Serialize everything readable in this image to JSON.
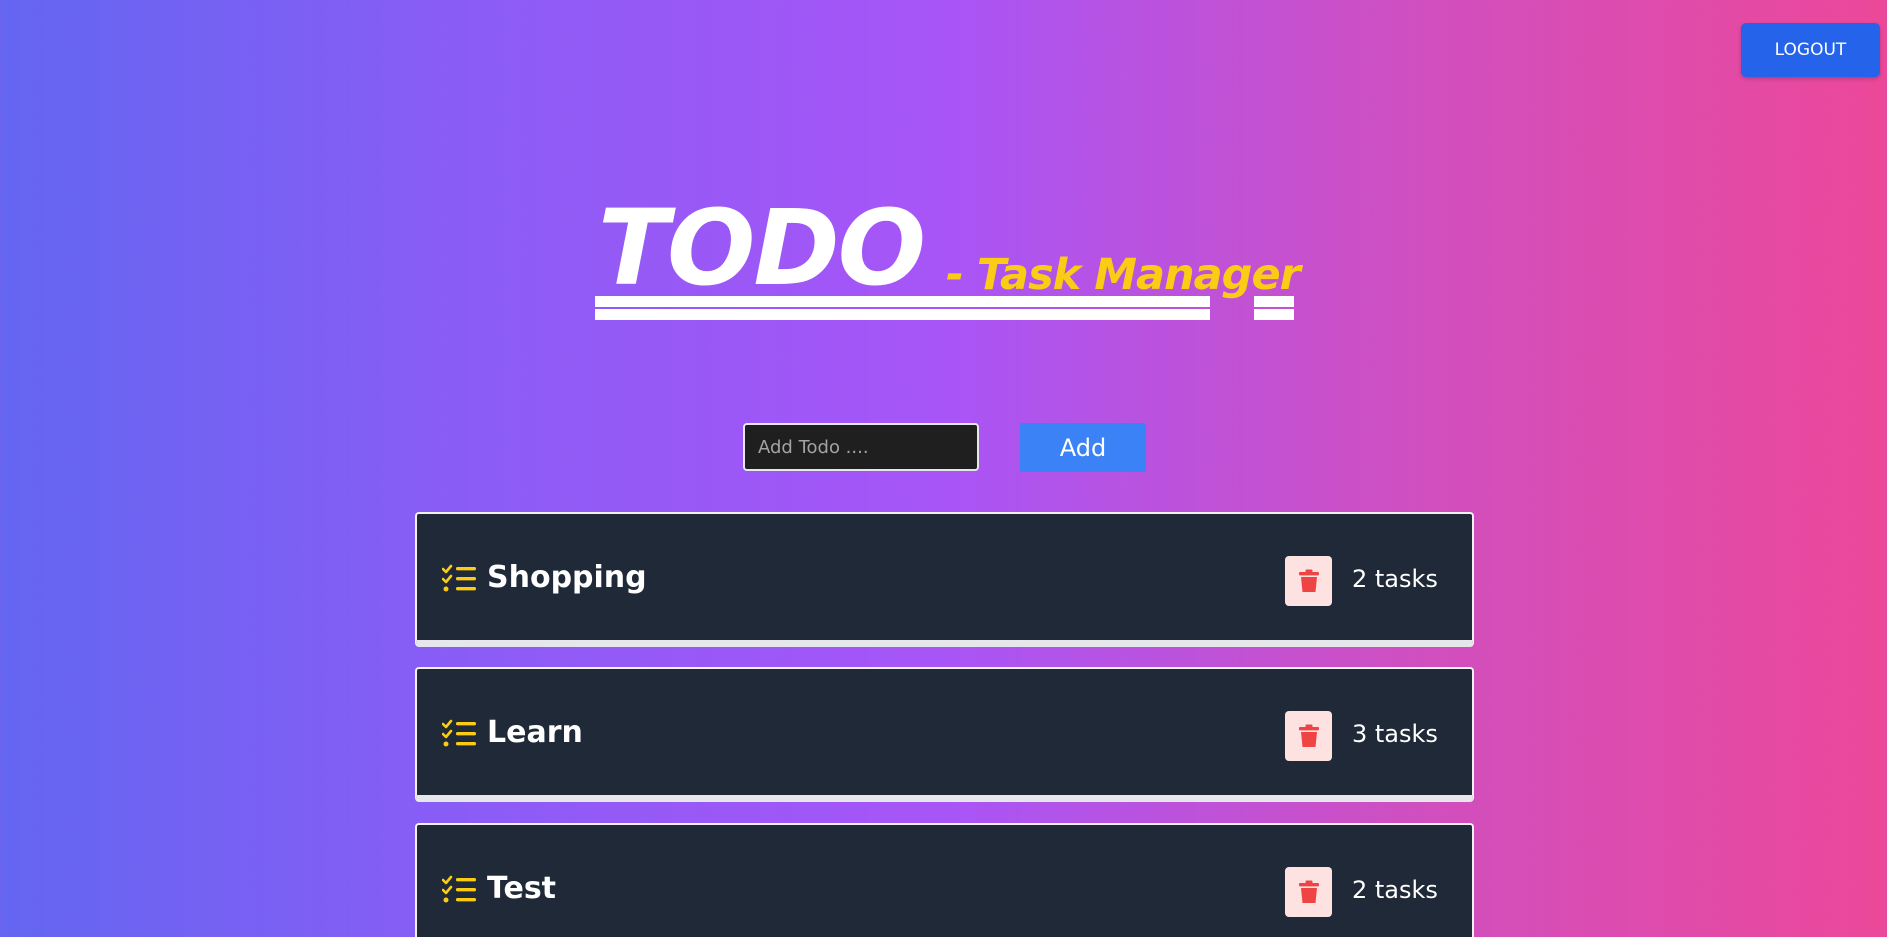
{
  "header": {
    "logout_label": "LOGOUT"
  },
  "hero": {
    "title": "TODO",
    "subtitle": "- Task Manager"
  },
  "add_form": {
    "placeholder": "Add Todo ....",
    "value": "",
    "add_label": "Add"
  },
  "todos": [
    {
      "title": "Shopping",
      "count_label": "2 tasks"
    },
    {
      "title": "Learn",
      "count_label": "3 tasks"
    },
    {
      "title": "Test",
      "count_label": "2 tasks"
    }
  ],
  "colors": {
    "accent_blue": "#2563eb",
    "add_blue": "#3b82f6",
    "subtitle_yellow": "#facc15",
    "card_bg": "#1f2937",
    "delete_bg": "#fee2e2",
    "delete_icon": "#ef4444",
    "gradient_start": "#6366f1",
    "gradient_end": "#ec4899"
  },
  "icons": {
    "list": "checklist-icon",
    "delete": "trash-icon"
  }
}
